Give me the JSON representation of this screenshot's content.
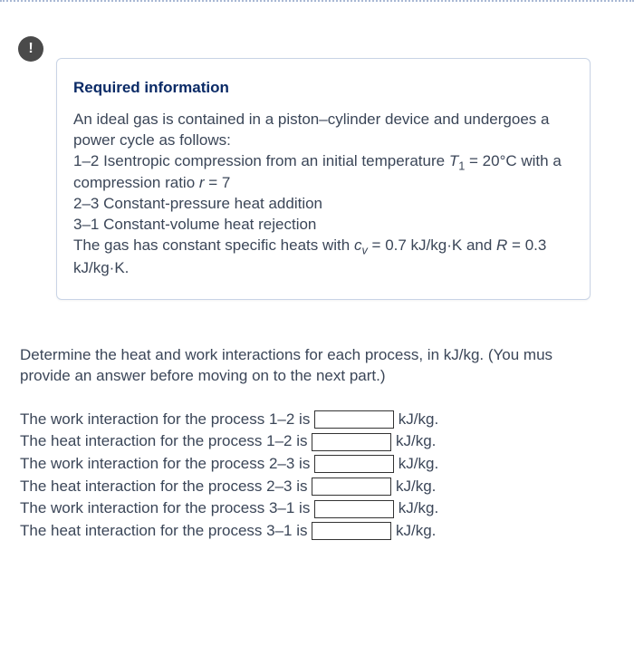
{
  "icon": {
    "exclaim_label": "!"
  },
  "info": {
    "title": "Required information",
    "para1_a": "An ideal gas is contained in a piston–cylinder device and undergoes a power cycle as follows:",
    "line12_a": "1–2 Isentropic compression from an initial temperature ",
    "T_var": "T",
    "T_sub": "1",
    "line12_b": " = 20°C with a compression ratio ",
    "r_var": "r",
    "r_eq": " = 7",
    "line23": "2–3 Constant-pressure heat addition",
    "line31": "3–1 Constant-volume heat rejection",
    "line_cv_a": "The gas has constant specific heats with ",
    "cv_var": "c",
    "cv_sub": "v",
    "cv_val": " = 0.7 kJ/kg·K and ",
    "R_var": "R",
    "R_val": " = 0.3 kJ/kg·K."
  },
  "question": {
    "text_a": "Determine the heat and work interactions for each process, in kJ/kg. (You mus",
    "text_b": "provide an answer before moving on to the next part.)"
  },
  "answers": [
    {
      "label": "The work interaction for the process 1–2 is ",
      "unit": " kJ/kg."
    },
    {
      "label": "The heat interaction for the process 1–2 is ",
      "unit": " kJ/kg."
    },
    {
      "label": "The work interaction for the process 2–3 is ",
      "unit": " kJ/kg."
    },
    {
      "label": "The heat interaction for the process 2–3 is ",
      "unit": " kJ/kg."
    },
    {
      "label": "The work interaction for the process 3–1 is ",
      "unit": " kJ/kg."
    },
    {
      "label": "The heat interaction for the process 3–1 is ",
      "unit": " kJ/kg."
    }
  ]
}
